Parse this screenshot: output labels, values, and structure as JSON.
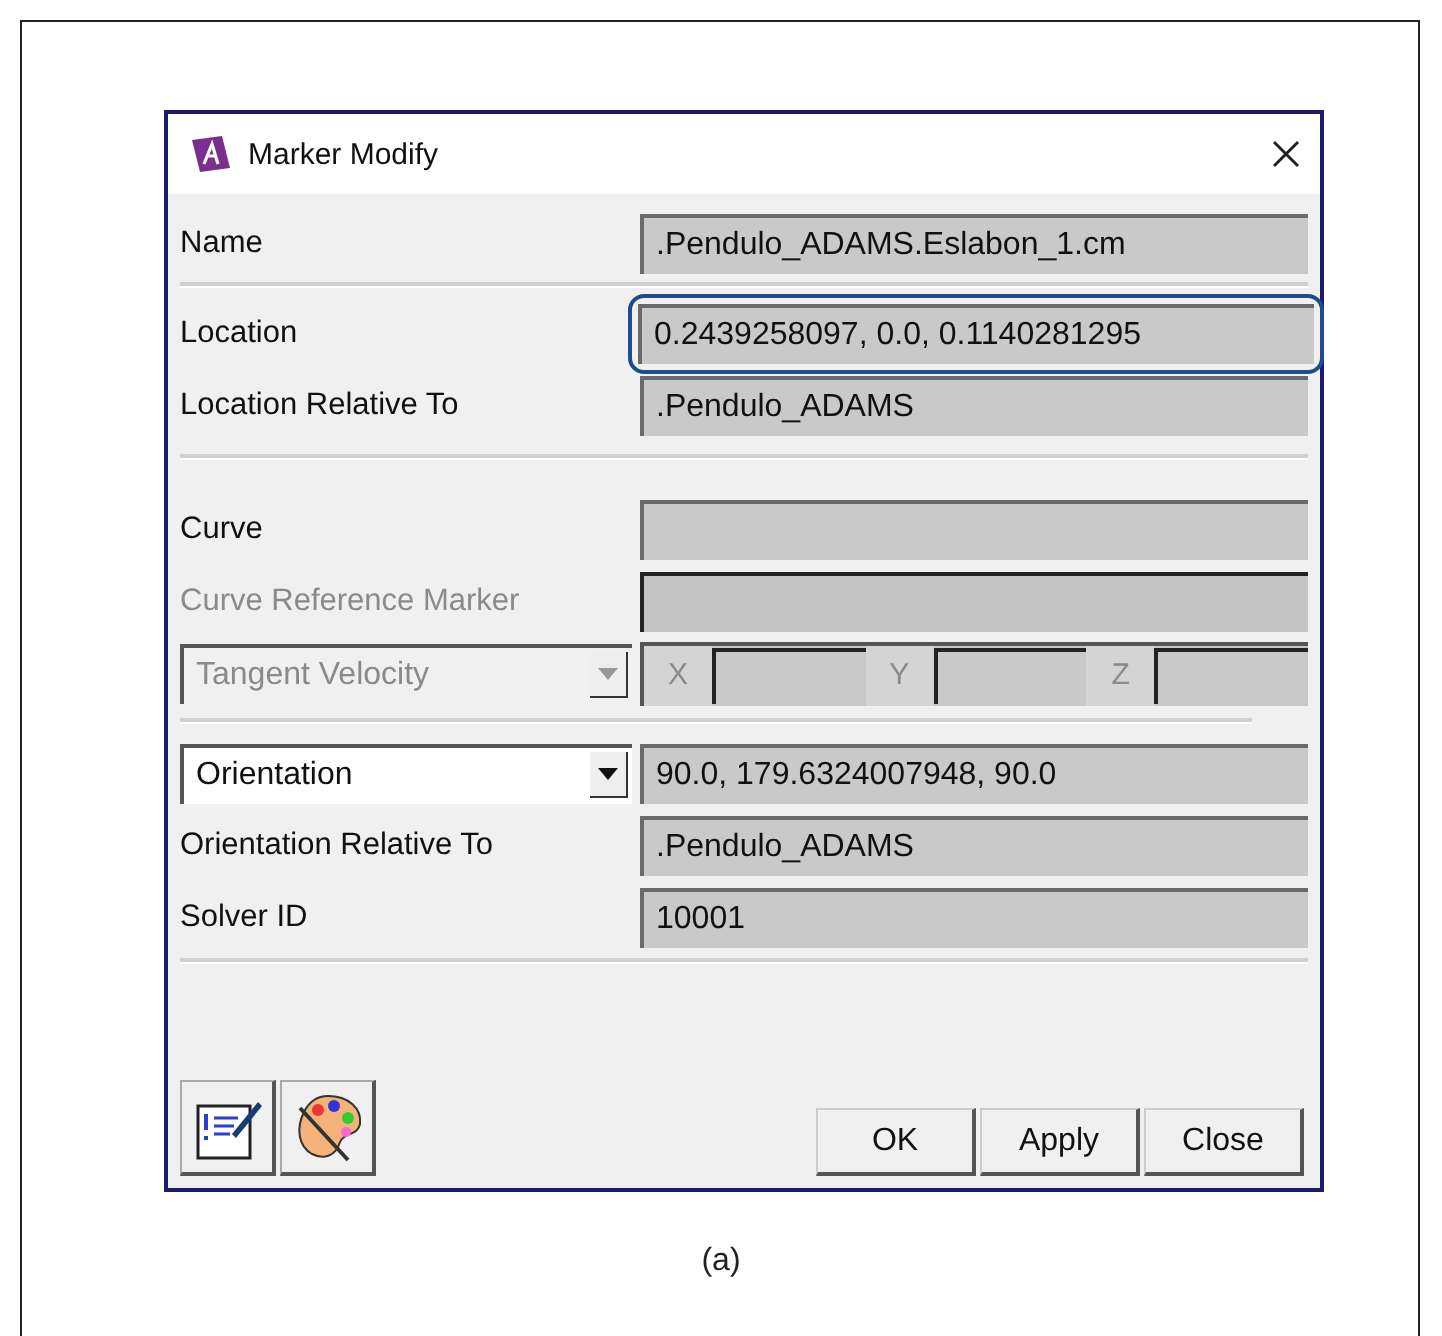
{
  "window": {
    "title": "Marker Modify"
  },
  "sections": [
    [
      {
        "kind": "field",
        "label": "Name",
        "value": ".Pendulo_ADAMS.Eslabon_1.cm",
        "disabled": false,
        "highlighted": false
      },
      {
        "kind": "divider"
      },
      {
        "kind": "field",
        "label": "Location",
        "value": "0.2439258097, 0.0, 0.1140281295",
        "disabled": false,
        "highlighted": true
      },
      {
        "kind": "field",
        "label": "Location Relative To",
        "value": ".Pendulo_ADAMS",
        "disabled": false,
        "highlighted": false
      }
    ],
    [
      {
        "kind": "field",
        "label": "Curve",
        "disabled": false,
        "highlighted": false
      },
      {
        "kind": "field",
        "label": "Curve Reference Marker",
        "disabled": true,
        "highlighted": false
      },
      {
        "kind": "vector",
        "dropdown": "Tangent Velocity",
        "disabled": true,
        "components": [
          {
            "label": "X"
          },
          {
            "label": "Y"
          },
          {
            "label": "Z"
          }
        ]
      }
    ],
    [
      {
        "kind": "select",
        "dropdown": "Orientation",
        "value": "90.0, 179.6324007948, 90.0",
        "disabled": false
      },
      {
        "kind": "field",
        "label": "Orientation Relative To",
        "value": ".Pendulo_ADAMS",
        "disabled": false,
        "highlighted": false
      },
      {
        "kind": "field",
        "label": "Solver ID",
        "value": "10001",
        "disabled": false,
        "highlighted": false
      }
    ]
  ],
  "buttons": [
    "OK",
    "Apply",
    "Close"
  ],
  "caption": "(a)"
}
